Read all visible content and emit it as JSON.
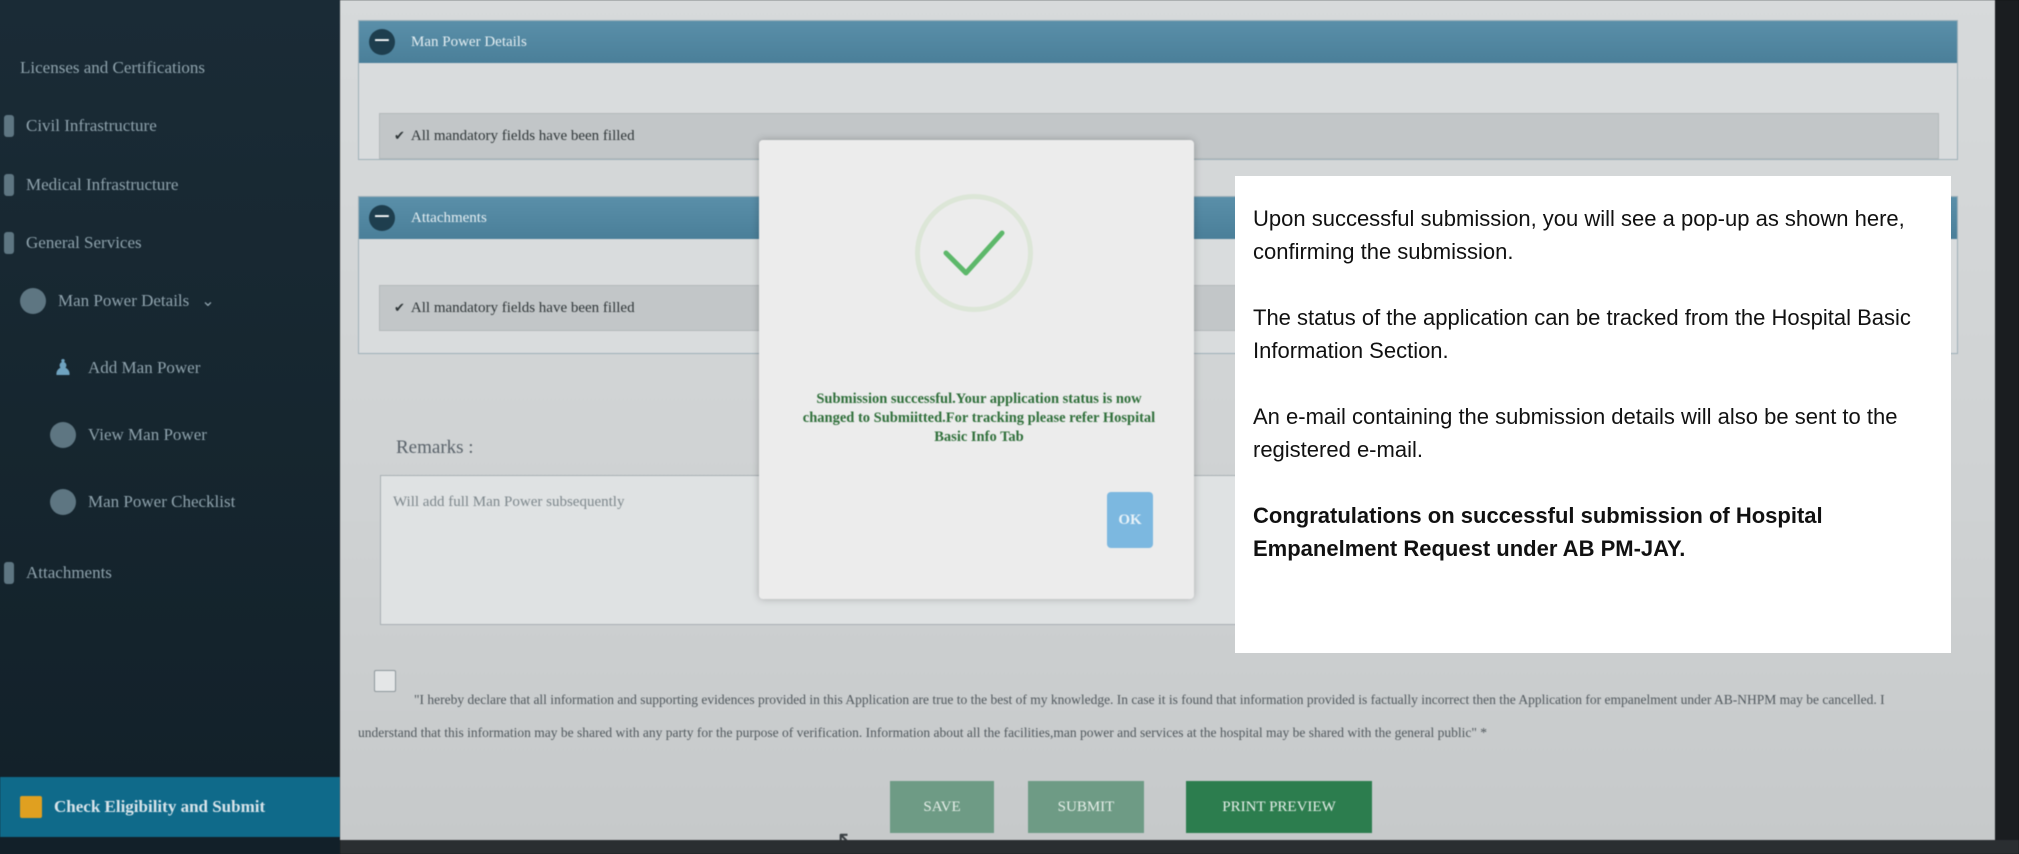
{
  "sidebar": {
    "items": [
      {
        "label": "Licenses and Certifications"
      },
      {
        "label": "Civil Infrastructure"
      },
      {
        "label": "Medical Infrastructure"
      },
      {
        "label": "General Services"
      },
      {
        "label": "Man Power Details"
      },
      {
        "label": "Add Man Power"
      },
      {
        "label": "View Man Power"
      },
      {
        "label": "Man Power Checklist"
      },
      {
        "label": "Attachments"
      },
      {
        "label": "Check Eligibility and Submit"
      }
    ]
  },
  "sections": {
    "manpower": {
      "title": "Man Power Details",
      "notice": "All mandatory fields have been filled"
    },
    "attachments": {
      "title": "Attachments",
      "notice": "All mandatory fields have been filled"
    }
  },
  "remarks": {
    "label": "Remarks :",
    "value": "Will add full Man Power subsequently"
  },
  "declaration": "\"I hereby declare that all information and supporting evidences provided in this Application are true to the best of my knowledge. In case it is found that information provided is factually incorrect then the Application for empanelment under AB-NHPM may be cancelled. I understand that this information may be shared with any party for the purpose of verification. Information about all the facilities,man power and services at the hospital may be shared with the general public\" *",
  "buttons": {
    "save": "SAVE",
    "submit": "SUBMIT",
    "print": "PRINT PREVIEW"
  },
  "modal": {
    "message": "Submission successful.Your application status is now changed to Submiitted.For tracking please refer Hospital Basic Info Tab",
    "ok": "OK"
  },
  "note": {
    "p1": "Upon successful submission, you will see a pop-up as shown here, confirming the submission.",
    "p2": "The status of the application can be tracked from the Hospital Basic Information Section.",
    "p3": "An e-mail containing the submission details will also be sent to the registered e-mail.",
    "p4": "Congratulations on successful submission of Hospital Empanelment Request under AB PM-JAY."
  },
  "colors": {
    "sidebar_bg": "#1a2b36",
    "section_header": "#5a8fa9",
    "active_item": "#0f6a8a",
    "print_button": "#2c7d4e",
    "success_green": "#2f6f3a",
    "ok_button": "#7cb8e0"
  },
  "icons": {
    "check": "check-icon",
    "minus": "minus-circle-icon",
    "person": "person-icon",
    "chevron": "chevron-down-icon"
  }
}
